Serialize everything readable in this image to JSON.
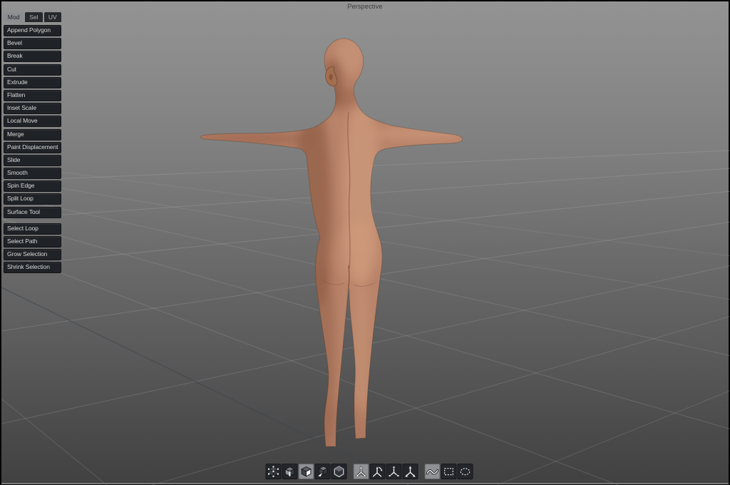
{
  "viewport": {
    "label": "Perspective",
    "bg_top": "#939393",
    "bg_bottom": "#414141",
    "grid_color": "#b4b4b4",
    "axis_color": "#3d4650"
  },
  "sidebar": {
    "tabs": [
      {
        "label": "Mod",
        "selected": true
      },
      {
        "label": "Sel",
        "selected": false
      },
      {
        "label": "UV",
        "selected": false
      }
    ],
    "tool_groups": [
      {
        "tools": [
          "Append Polygon",
          "Bevel",
          "Break",
          "Cut",
          "Extrude",
          "Flatten",
          "Inset Scale",
          "Local Move",
          "Merge",
          "Paint Displacement",
          "Slide",
          "Smooth",
          "Spin Edge",
          "Split Loop",
          "Surface Tool"
        ]
      },
      {
        "tools": [
          "Select Loop",
          "Select Path",
          "Grow Selection",
          "Shrink Selection"
        ]
      }
    ]
  },
  "toolbar": {
    "component_modes": [
      {
        "name": "vertices-mode",
        "selected": false
      },
      {
        "name": "edges-mode",
        "selected": false
      },
      {
        "name": "polygons-mode",
        "selected": true
      },
      {
        "name": "items-mode",
        "selected": false
      },
      {
        "name": "materials-mode",
        "selected": false
      }
    ],
    "action_centers": [
      {
        "name": "action-center-automatic",
        "selected": true
      },
      {
        "name": "action-center-rotate",
        "selected": false
      },
      {
        "name": "action-center-element",
        "selected": false
      },
      {
        "name": "action-center-origin",
        "selected": false
      }
    ],
    "selection_styles": [
      {
        "name": "lasso-selection",
        "selected": true
      },
      {
        "name": "rectangle-selection",
        "selected": false
      },
      {
        "name": "ellipse-selection",
        "selected": false
      }
    ]
  },
  "model": {
    "description": "human figure, back view, T-pose",
    "skin_base": "#b9846a",
    "skin_shadow": "#7d4b36",
    "skin_highlight": "#d7a384"
  }
}
